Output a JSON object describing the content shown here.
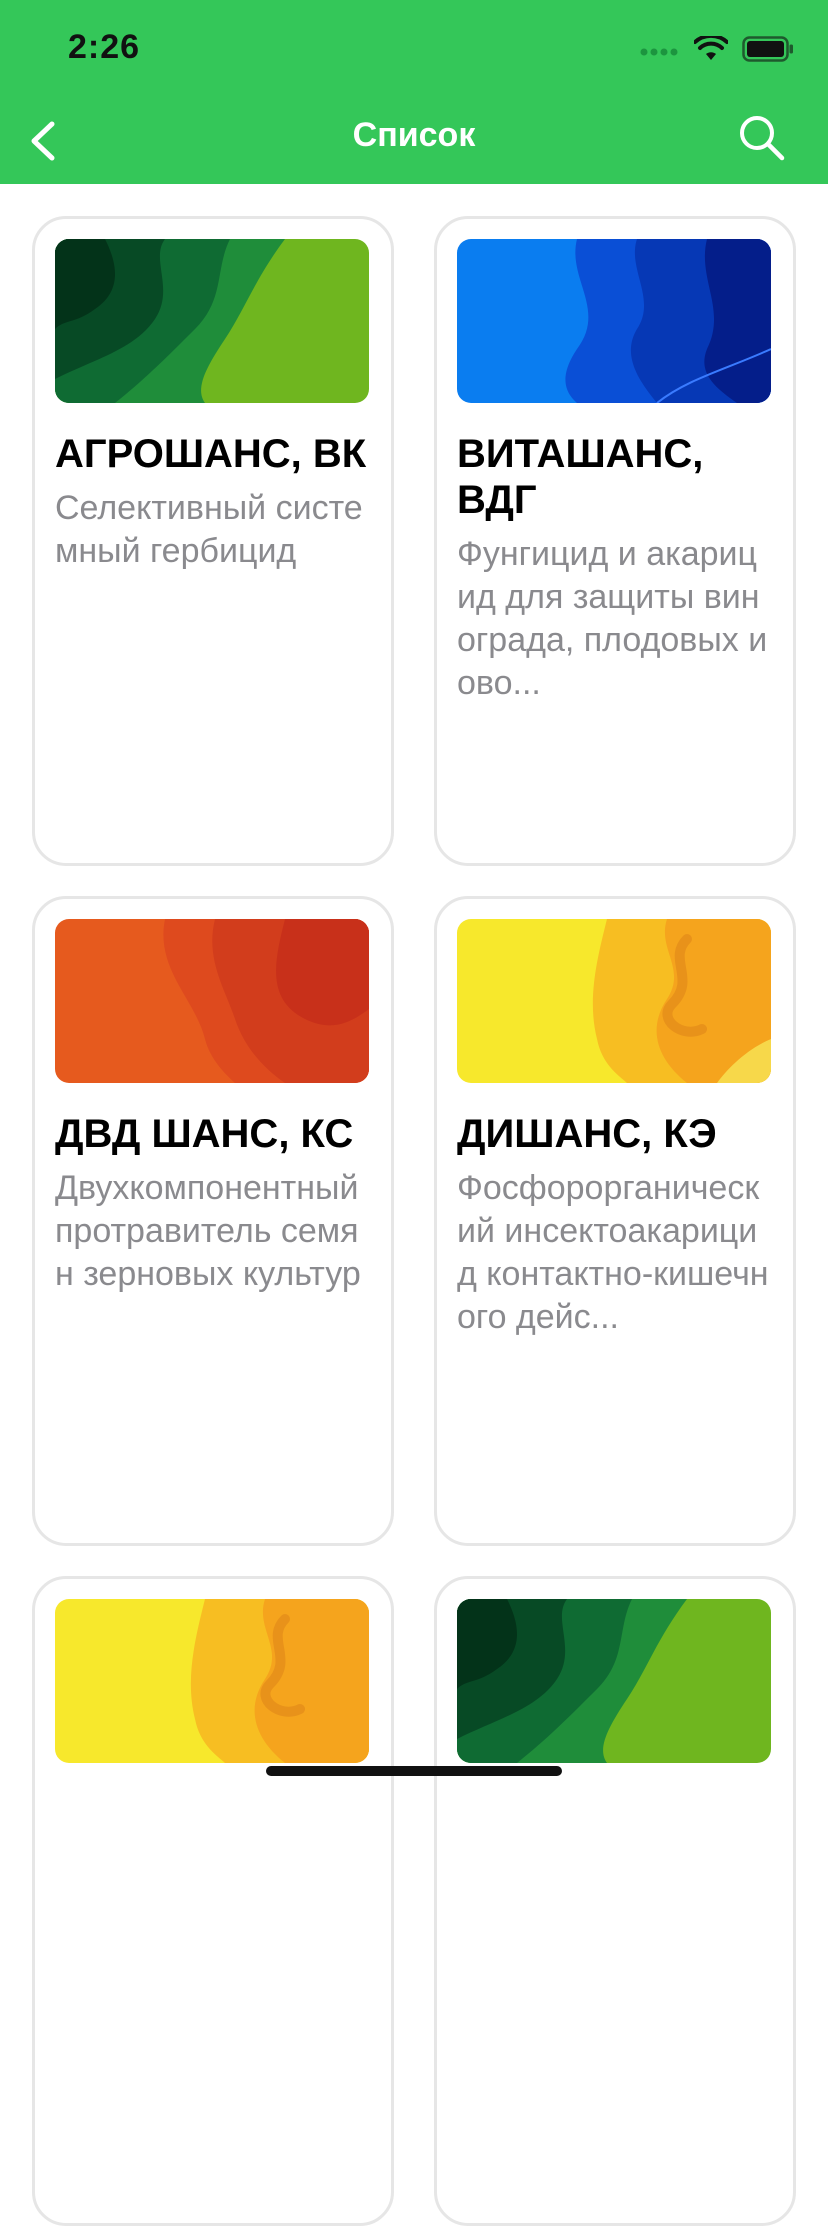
{
  "status_bar": {
    "time": "2:26"
  },
  "nav": {
    "title": "Список",
    "back_icon": "chevron-left-icon",
    "search_icon": "search-icon"
  },
  "colors": {
    "accent": "#34c759"
  },
  "products": [
    {
      "name": "АГРОШАНС, ВК",
      "description": "Селективный системный гербицид",
      "theme": "green"
    },
    {
      "name": "ВИТАШАНС, ВДГ",
      "description": "Фунгицид и акарицид для защиты винограда, плодовых и ово...",
      "theme": "blue"
    },
    {
      "name": "ДВД ШАНС, КС",
      "description": "Двухкомпонентный протравитель семян зерновых культур",
      "theme": "red"
    },
    {
      "name": "ДИШАНС, КЭ",
      "description": "Фосфорорганический инсектоакарицид контактно-кишечного дейс...",
      "theme": "yellow"
    },
    {
      "name": "",
      "description": "",
      "theme": "yellow"
    },
    {
      "name": "",
      "description": "",
      "theme": "green"
    }
  ]
}
